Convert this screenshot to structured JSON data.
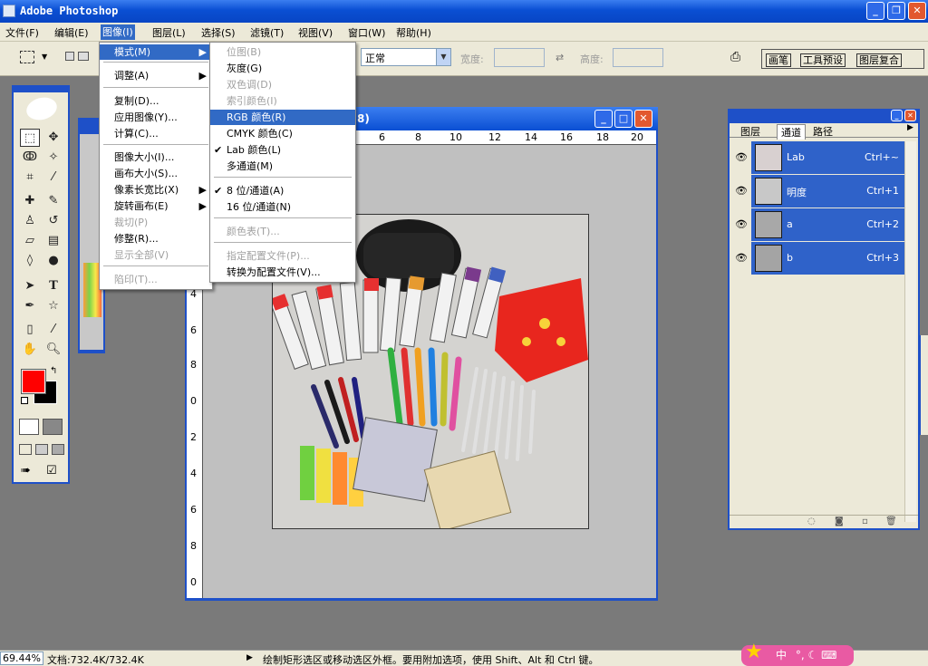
{
  "app": {
    "title": "Adobe Photoshop"
  },
  "menubar": {
    "items": [
      "文件(F)",
      "编辑(E)",
      "图像(I)",
      "图层(L)",
      "选择(S)",
      "滤镜(T)",
      "视图(V)",
      "窗口(W)",
      "帮助(H)"
    ],
    "active": "图像(I)"
  },
  "options": {
    "mode_value": "正常",
    "width_label": "宽度:",
    "height_label": "高度:",
    "wells": [
      "画笔",
      "工具预设",
      "图层复合"
    ]
  },
  "image_menu": {
    "items": [
      {
        "label": "模式(M)",
        "submenu": true,
        "highlight": true
      },
      {
        "label": "调整(A)",
        "submenu": true
      },
      {
        "label": "复制(D)..."
      },
      {
        "label": "应用图像(Y)..."
      },
      {
        "label": "计算(C)..."
      },
      {
        "label": "图像大小(I)..."
      },
      {
        "label": "画布大小(S)..."
      },
      {
        "label": "像素长宽比(X)",
        "submenu": true
      },
      {
        "label": "旋转画布(E)",
        "submenu": true
      },
      {
        "label": "裁切(P)",
        "disabled": true
      },
      {
        "label": "修整(R)..."
      },
      {
        "label": "显示全部(V)",
        "disabled": true
      },
      {
        "label": "陷印(T)...",
        "disabled": true
      }
    ]
  },
  "mode_menu": {
    "items": [
      {
        "label": "位图(B)",
        "disabled": true
      },
      {
        "label": "灰度(G)"
      },
      {
        "label": "双色调(D)",
        "disabled": true
      },
      {
        "label": "索引颜色(I)",
        "disabled": true
      },
      {
        "label": "RGB 颜色(R)",
        "highlight": true
      },
      {
        "label": "CMYK 颜色(C)"
      },
      {
        "label": "Lab 颜色(L)",
        "checked": true
      },
      {
        "label": "多通道(M)"
      },
      {
        "label": "8 位/通道(A)",
        "checked": true
      },
      {
        "label": "16 位/通道(N)"
      },
      {
        "label": "颜色表(T)...",
        "disabled": true
      },
      {
        "label": "指定配置文件(P)...",
        "disabled": true
      },
      {
        "label": "转换为配置文件(V)..."
      }
    ]
  },
  "document": {
    "title_fragment": "8)",
    "ruler_h": [
      "6",
      "8",
      "10",
      "12",
      "14",
      "16",
      "18",
      "20"
    ],
    "ruler_v": [
      "0",
      "2",
      "4",
      "6",
      "8",
      "0",
      "2",
      "4",
      "6",
      "8",
      "0"
    ]
  },
  "channels_panel": {
    "tabs": [
      "图层",
      "通道",
      "路径"
    ],
    "active_tab": "通道",
    "channels": [
      {
        "name": "Lab",
        "shortcut": "Ctrl+~"
      },
      {
        "name": "明度",
        "shortcut": "Ctrl+1"
      },
      {
        "name": "a",
        "shortcut": "Ctrl+2"
      },
      {
        "name": "b",
        "shortcut": "Ctrl+3"
      }
    ]
  },
  "status": {
    "zoom": "69.44%",
    "doc_size": "文档:732.4K/732.4K",
    "hint": "绘制矩形选区或移动选区外框。要用附加选项，使用 Shift、Alt 和 Ctrl 键。"
  },
  "ime": {
    "label": "中"
  },
  "colors": {
    "foreground": "#ff0000",
    "background": "#000000",
    "accent": "#316ac5"
  }
}
